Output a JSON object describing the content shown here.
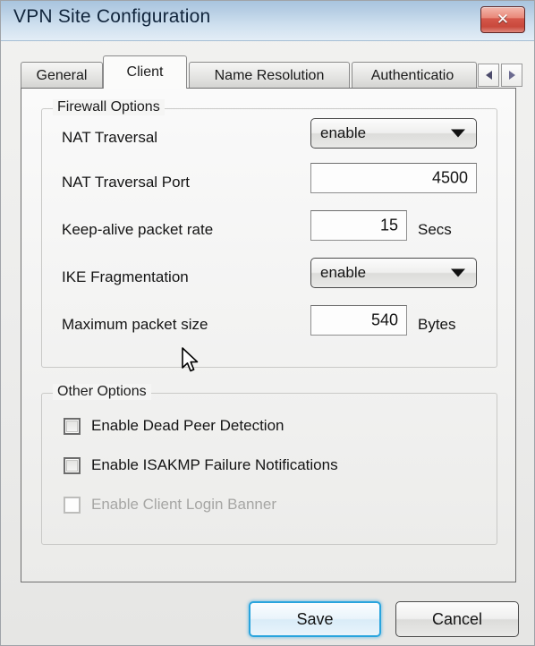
{
  "window": {
    "title": "VPN Site Configuration",
    "close_icon": "close-icon",
    "close_glyph": "✕"
  },
  "tabs": {
    "items": [
      {
        "label": "General",
        "active": false
      },
      {
        "label": "Client",
        "active": true
      },
      {
        "label": "Name Resolution",
        "active": false
      },
      {
        "label": "Authenticatio",
        "active": false
      }
    ],
    "scroll_prev_icon": "chevron-left-icon",
    "scroll_next_icon": "chevron-right-icon"
  },
  "firewall": {
    "title": "Firewall Options",
    "nat_traversal": {
      "label": "NAT Traversal",
      "value": "enable",
      "arrow_icon": "chevron-down-icon"
    },
    "nat_traversal_port": {
      "label": "NAT Traversal Port",
      "value": "4500"
    },
    "keepalive": {
      "label": "Keep-alive packet rate",
      "value": "15",
      "unit": "Secs"
    },
    "ike_fragmentation": {
      "label": "IKE Fragmentation",
      "value": "enable",
      "arrow_icon": "chevron-down-icon"
    },
    "max_packet_size": {
      "label": "Maximum packet size",
      "value": "540",
      "unit": "Bytes"
    }
  },
  "other": {
    "title": "Other Options",
    "checkboxes": [
      {
        "label": "Enable Dead Peer Detection",
        "checked": true,
        "disabled": false
      },
      {
        "label": "Enable ISAKMP Failure Notifications",
        "checked": true,
        "disabled": false
      },
      {
        "label": "Enable Client Login Banner",
        "checked": false,
        "disabled": true
      }
    ]
  },
  "footer": {
    "save_label": "Save",
    "cancel_label": "Cancel"
  },
  "colors": {
    "titlebar_accent": "#b9d0e5",
    "close_button": "#c9493c",
    "default_button_border": "#29a4dd"
  }
}
